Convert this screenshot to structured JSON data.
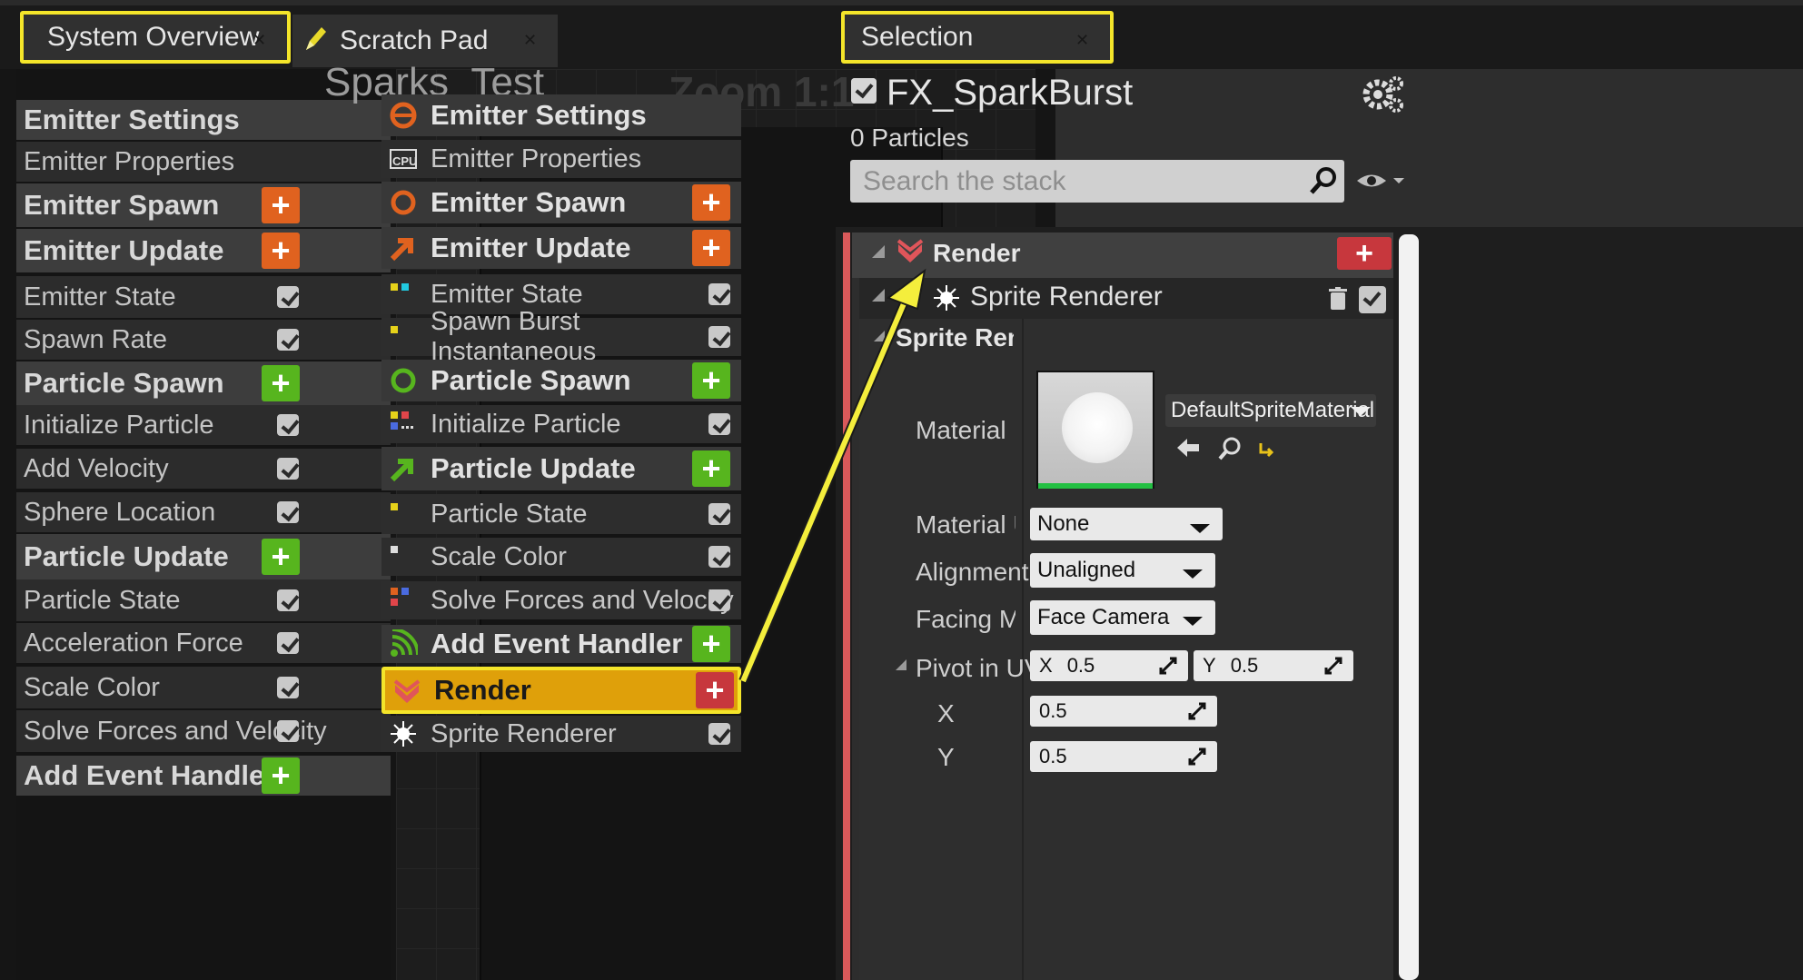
{
  "tabs": [
    {
      "label": "System Overview",
      "highlighted": true
    },
    {
      "label": "Scratch Pad",
      "highlighted": false
    },
    {
      "label": "Selection",
      "highlighted": true
    }
  ],
  "graph": {
    "title": "Sparks_Test",
    "zoom": "Zoom 1:1"
  },
  "left_list": [
    {
      "label": "Emitter Settings",
      "kind": "head"
    },
    {
      "label": "Emitter Properties",
      "kind": "item"
    },
    {
      "label": "Emitter Spawn",
      "kind": "head",
      "add": "orange"
    },
    {
      "label": "Emitter Update",
      "kind": "head",
      "add": "orange"
    },
    {
      "label": "Emitter State",
      "kind": "item",
      "checked": true
    },
    {
      "label": "Spawn Rate",
      "kind": "item",
      "checked": true
    },
    {
      "label": "Particle Spawn",
      "kind": "head",
      "add": "green"
    },
    {
      "label": "Initialize Particle",
      "kind": "item",
      "checked": true
    },
    {
      "label": "Add Velocity",
      "kind": "item",
      "checked": true
    },
    {
      "label": "Sphere Location",
      "kind": "item",
      "checked": true
    },
    {
      "label": "Particle Update",
      "kind": "head",
      "add": "green"
    },
    {
      "label": "Particle State",
      "kind": "item",
      "checked": true
    },
    {
      "label": "Acceleration Force",
      "kind": "item",
      "checked": true
    },
    {
      "label": "Scale Color",
      "kind": "item",
      "checked": true
    },
    {
      "label": "Solve Forces and Velocity",
      "kind": "item",
      "checked": true
    },
    {
      "label": "Add Event Handler",
      "kind": "head",
      "add": "green"
    }
  ],
  "node_stack": [
    {
      "label": "Emitter Settings",
      "kind": "head",
      "icon": "emitter-settings-icon"
    },
    {
      "label": "Emitter Properties",
      "kind": "item",
      "icon": "cpu-icon"
    },
    {
      "label": "Emitter Spawn",
      "kind": "head",
      "icon": "emitter-spawn-icon",
      "add": "orange"
    },
    {
      "label": "Emitter Update",
      "kind": "head",
      "icon": "emitter-update-icon",
      "add": "orange"
    },
    {
      "label": "Emitter State",
      "kind": "item",
      "icon": "emitter-state-icon",
      "checked": true
    },
    {
      "label": "Spawn Burst Instantaneous",
      "kind": "item",
      "icon": "spawn-burst-icon",
      "checked": true
    },
    {
      "label": "Particle Spawn",
      "kind": "head",
      "icon": "particle-spawn-icon",
      "add": "green"
    },
    {
      "label": "Initialize Particle",
      "kind": "item",
      "icon": "initialize-particle-icon",
      "checked": true
    },
    {
      "label": "Particle Update",
      "kind": "head",
      "icon": "particle-update-icon",
      "add": "green"
    },
    {
      "label": "Particle State",
      "kind": "item",
      "icon": "particle-state-icon",
      "checked": true
    },
    {
      "label": "Scale Color",
      "kind": "item",
      "icon": "scale-color-icon",
      "checked": true
    },
    {
      "label": "Solve Forces and Velocity",
      "kind": "item",
      "icon": "solve-forces-icon",
      "checked": true
    },
    {
      "label": "Add Event Handler",
      "kind": "head",
      "icon": "event-handler-icon",
      "add": "green"
    },
    {
      "label": "Render",
      "kind": "render",
      "icon": "render-icon",
      "add": "red"
    },
    {
      "label": "Sprite Renderer",
      "kind": "item",
      "icon": "sprite-renderer-icon",
      "checked": true
    }
  ],
  "selection": {
    "emitter_name": "FX_SparkBurst",
    "particles": "0 Particles",
    "search_placeholder": "Search the stack",
    "render_label": "Render",
    "sprite_renderer_label": "Sprite Renderer",
    "group_label": "Sprite Renc",
    "material_label": "Material",
    "material_value": "DefaultSpriteMaterial",
    "material_usage_label": "Material Us",
    "material_usage_value": "None",
    "alignment_label": "Alignment",
    "alignment_value": "Unaligned",
    "facing_label": "Facing Moc",
    "facing_value": "Face Camera",
    "pivot_label": "Pivot in UV",
    "pivot_x_prefix": "X",
    "pivot_x_value": "0.5",
    "pivot_y_prefix": "Y",
    "pivot_y_value": "0.5",
    "x_label": "X",
    "x_value": "0.5",
    "y_label": "Y",
    "y_value": "0.5"
  },
  "colors": {
    "highlight": "#f4e52a",
    "add_orange": "#e0621f",
    "add_green": "#57b51e",
    "add_red": "#c7373d",
    "render_row": "#dfa00a",
    "red_accent": "#d9595a"
  },
  "icons": [
    "pencil-icon",
    "gear-icon",
    "eye-icon",
    "magnifier-icon",
    "trash-icon",
    "back-arrow-icon",
    "browse-icon",
    "reset-icon",
    "close-icon"
  ]
}
